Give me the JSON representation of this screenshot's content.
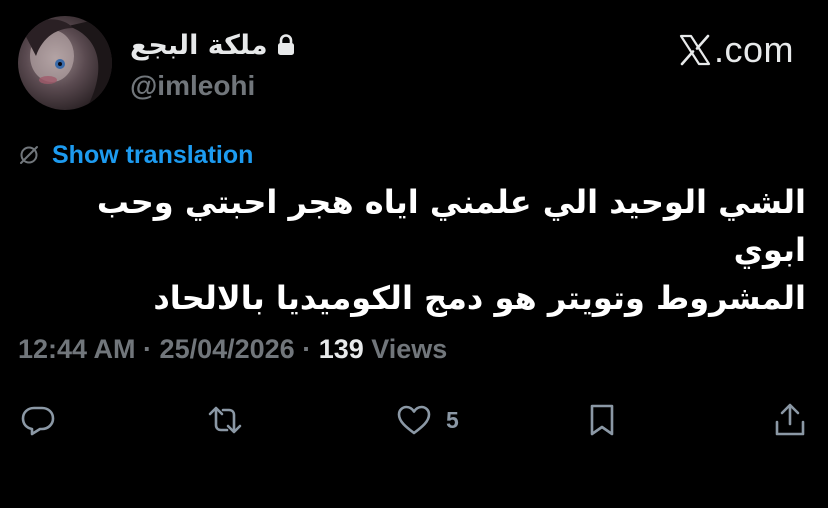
{
  "user": {
    "display_name": "ملكة البجع",
    "handle": "@imleohi",
    "locked": true,
    "avatar": "profile-photo"
  },
  "brand": {
    "logo_text": ".com",
    "logo_icon": "x-logo-icon"
  },
  "translation": {
    "icon": "globe-slash-icon",
    "label": "Show translation",
    "color": "#1d9bf0"
  },
  "tweet": {
    "text_line1": "الشي الوحيد الي علمني اياه هجر احبتي وحب ابوي",
    "text_line2": "المشروط وتويتر هو دمج الكوميديا بالالحاد"
  },
  "meta": {
    "time": "12:44 AM",
    "separator": " · ",
    "date": "25/04/2026",
    "views_count": "139",
    "views_label": " Views"
  },
  "actions": {
    "reply_icon": "reply-icon",
    "retweet_icon": "retweet-icon",
    "like_icon": "heart-icon",
    "like_count": "5",
    "bookmark_icon": "bookmark-icon",
    "share_icon": "share-icon"
  },
  "colors": {
    "background": "#000000",
    "text_primary": "#e7e9ea",
    "text_secondary": "#71767b",
    "link": "#1d9bf0"
  }
}
